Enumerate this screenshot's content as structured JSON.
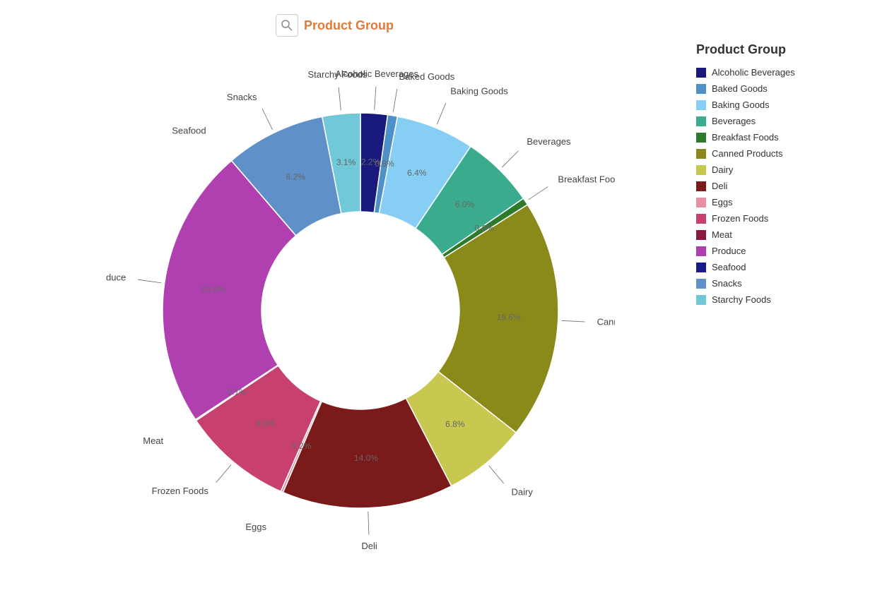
{
  "title": "Product Group",
  "icon": "🔍",
  "legend": {
    "title": "Product Group",
    "items": [
      {
        "label": "Alcoholic Beverages",
        "color": "#1a1a7e"
      },
      {
        "label": "Baked Goods",
        "color": "#4e90c8"
      },
      {
        "label": "Baking Goods",
        "color": "#87cef5"
      },
      {
        "label": "Beverages",
        "color": "#3aab8c"
      },
      {
        "label": "Breakfast Foods",
        "color": "#2d7a2d"
      },
      {
        "label": "Canned Products",
        "color": "#8a8a1a"
      },
      {
        "label": "Dairy",
        "color": "#c8c850"
      },
      {
        "label": "Deli",
        "color": "#7a1a1a"
      },
      {
        "label": "Eggs",
        "color": "#e88fa0"
      },
      {
        "label": "Frozen Foods",
        "color": "#c84070"
      },
      {
        "label": "Meat",
        "color": "#8a1a40"
      },
      {
        "label": "Produce",
        "color": "#b040b0"
      },
      {
        "label": "Seafood",
        "color": "#1a1a8a"
      },
      {
        "label": "Snacks",
        "color": "#6090c8"
      },
      {
        "label": "Starchy Foods",
        "color": "#70c8d8"
      }
    ]
  },
  "segments": [
    {
      "label": "Alcoholic Beverages",
      "pct": 2.2,
      "color": "#1a1a7e"
    },
    {
      "label": "Baked Goods",
      "pct": 0.8,
      "color": "#4e90c8"
    },
    {
      "label": "Baking Goods",
      "pct": 6.4,
      "color": "#87cef5"
    },
    {
      "label": "Beverages",
      "pct": 6.0,
      "color": "#3aab8c"
    },
    {
      "label": "Breakfast Foods",
      "pct": 0.6,
      "color": "#2d7a2d"
    },
    {
      "label": "Canned Products",
      "pct": 19.6,
      "color": "#8a8a1a"
    },
    {
      "label": "Dairy",
      "pct": 6.8,
      "color": "#c8c850"
    },
    {
      "label": "Deli",
      "pct": 14.0,
      "color": "#7a1a1a"
    },
    {
      "label": "Eggs",
      "pct": 0.2,
      "color": "#e88fa0"
    },
    {
      "label": "Frozen Foods",
      "pct": 9.0,
      "color": "#c84070"
    },
    {
      "label": "Meat",
      "pct": 0.1,
      "color": "#8a1a40"
    },
    {
      "label": "Produce",
      "pct": 23.0,
      "color": "#b040b0"
    },
    {
      "label": "Seafood",
      "pct": 0.0,
      "color": "#1a1a8a"
    },
    {
      "label": "Snacks",
      "pct": 8.2,
      "color": "#6090c8"
    },
    {
      "label": "Starchy Foods",
      "pct": 3.1,
      "color": "#70c8d8"
    }
  ]
}
